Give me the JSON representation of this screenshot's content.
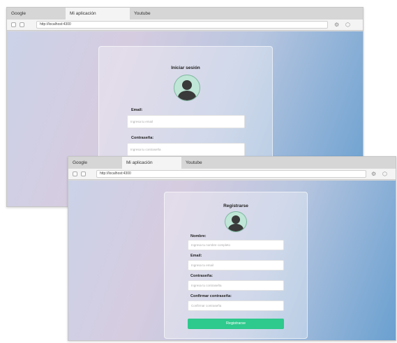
{
  "browser": {
    "tabs": [
      "Google",
      "Mi aplicación",
      "Youtube"
    ],
    "url": "http://localhost:4300"
  },
  "login": {
    "title": "Iniciar sesión",
    "email_label": "Email:",
    "email_placeholder": "Ingresa tu email",
    "password_label": "Contraseña:",
    "password_placeholder": "Ingresa tu contraseña"
  },
  "register": {
    "title": "Registrarse",
    "name_label": "Nombre:",
    "name_placeholder": "Ingresa tu nombre completo",
    "email_label": "Email:",
    "email_placeholder": "Ingresa tu email",
    "password_label": "Contraseña:",
    "password_placeholder": "Ingresa tu contraseña",
    "confirm_label": "Confirmar contraseña:",
    "confirm_placeholder": "Confirmar contraseña",
    "submit_label": "Registrarse"
  },
  "colors": {
    "submit_button": "#2ec98c",
    "gradient_end": "#6aa0d0",
    "avatar_bg": "#bfe6d6"
  },
  "icons": [
    "back-icon",
    "forward-icon",
    "settings-icon",
    "extensions-icon",
    "user-avatar-icon"
  ]
}
